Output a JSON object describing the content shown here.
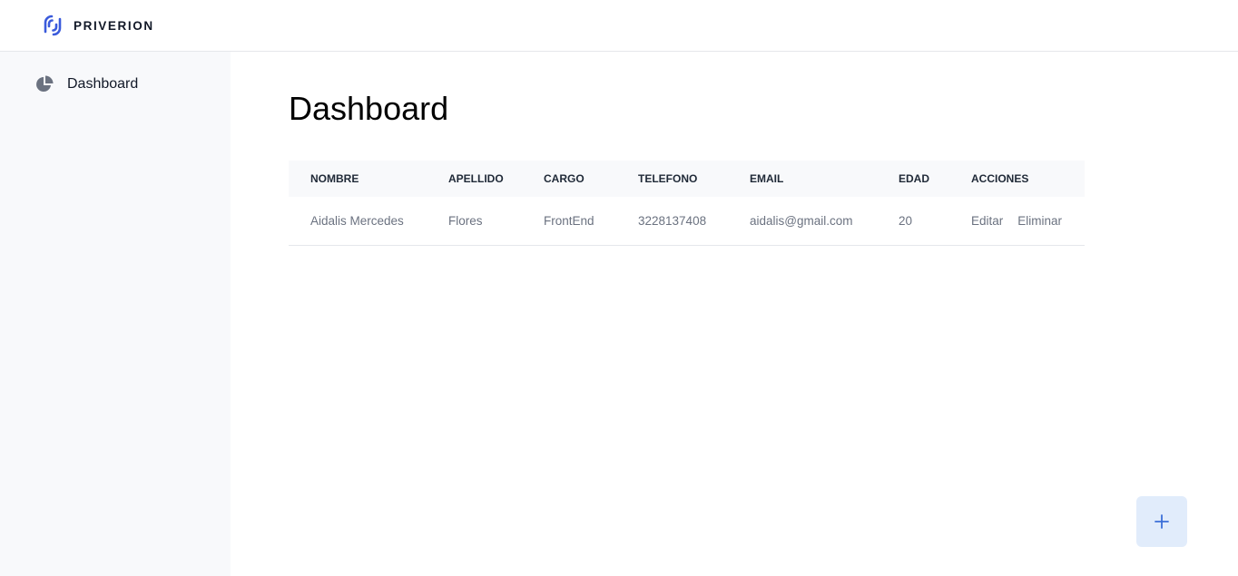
{
  "app": {
    "brand_name": "PRIVERION",
    "brand_color": "#3b5bdb"
  },
  "sidebar": {
    "items": [
      {
        "label": "Dashboard",
        "icon": "pie-chart-icon"
      }
    ]
  },
  "main": {
    "title": "Dashboard",
    "table": {
      "columns": [
        "NOMBRE",
        "APELLIDO",
        "CARGO",
        "TELEFONO",
        "EMAIL",
        "EDAD",
        "ACCIONES"
      ],
      "rows": [
        {
          "nombre": "Aidalis Mercedes",
          "apellido": "Flores",
          "cargo": "FrontEnd",
          "telefono": "3228137408",
          "email": "aidalis@gmail.com",
          "edad": "20",
          "actions": [
            "Editar",
            "Eliminar"
          ]
        }
      ]
    },
    "fab": {
      "icon": "plus-icon",
      "color": "#3b6fd8",
      "background": "#e1ecfb"
    }
  }
}
